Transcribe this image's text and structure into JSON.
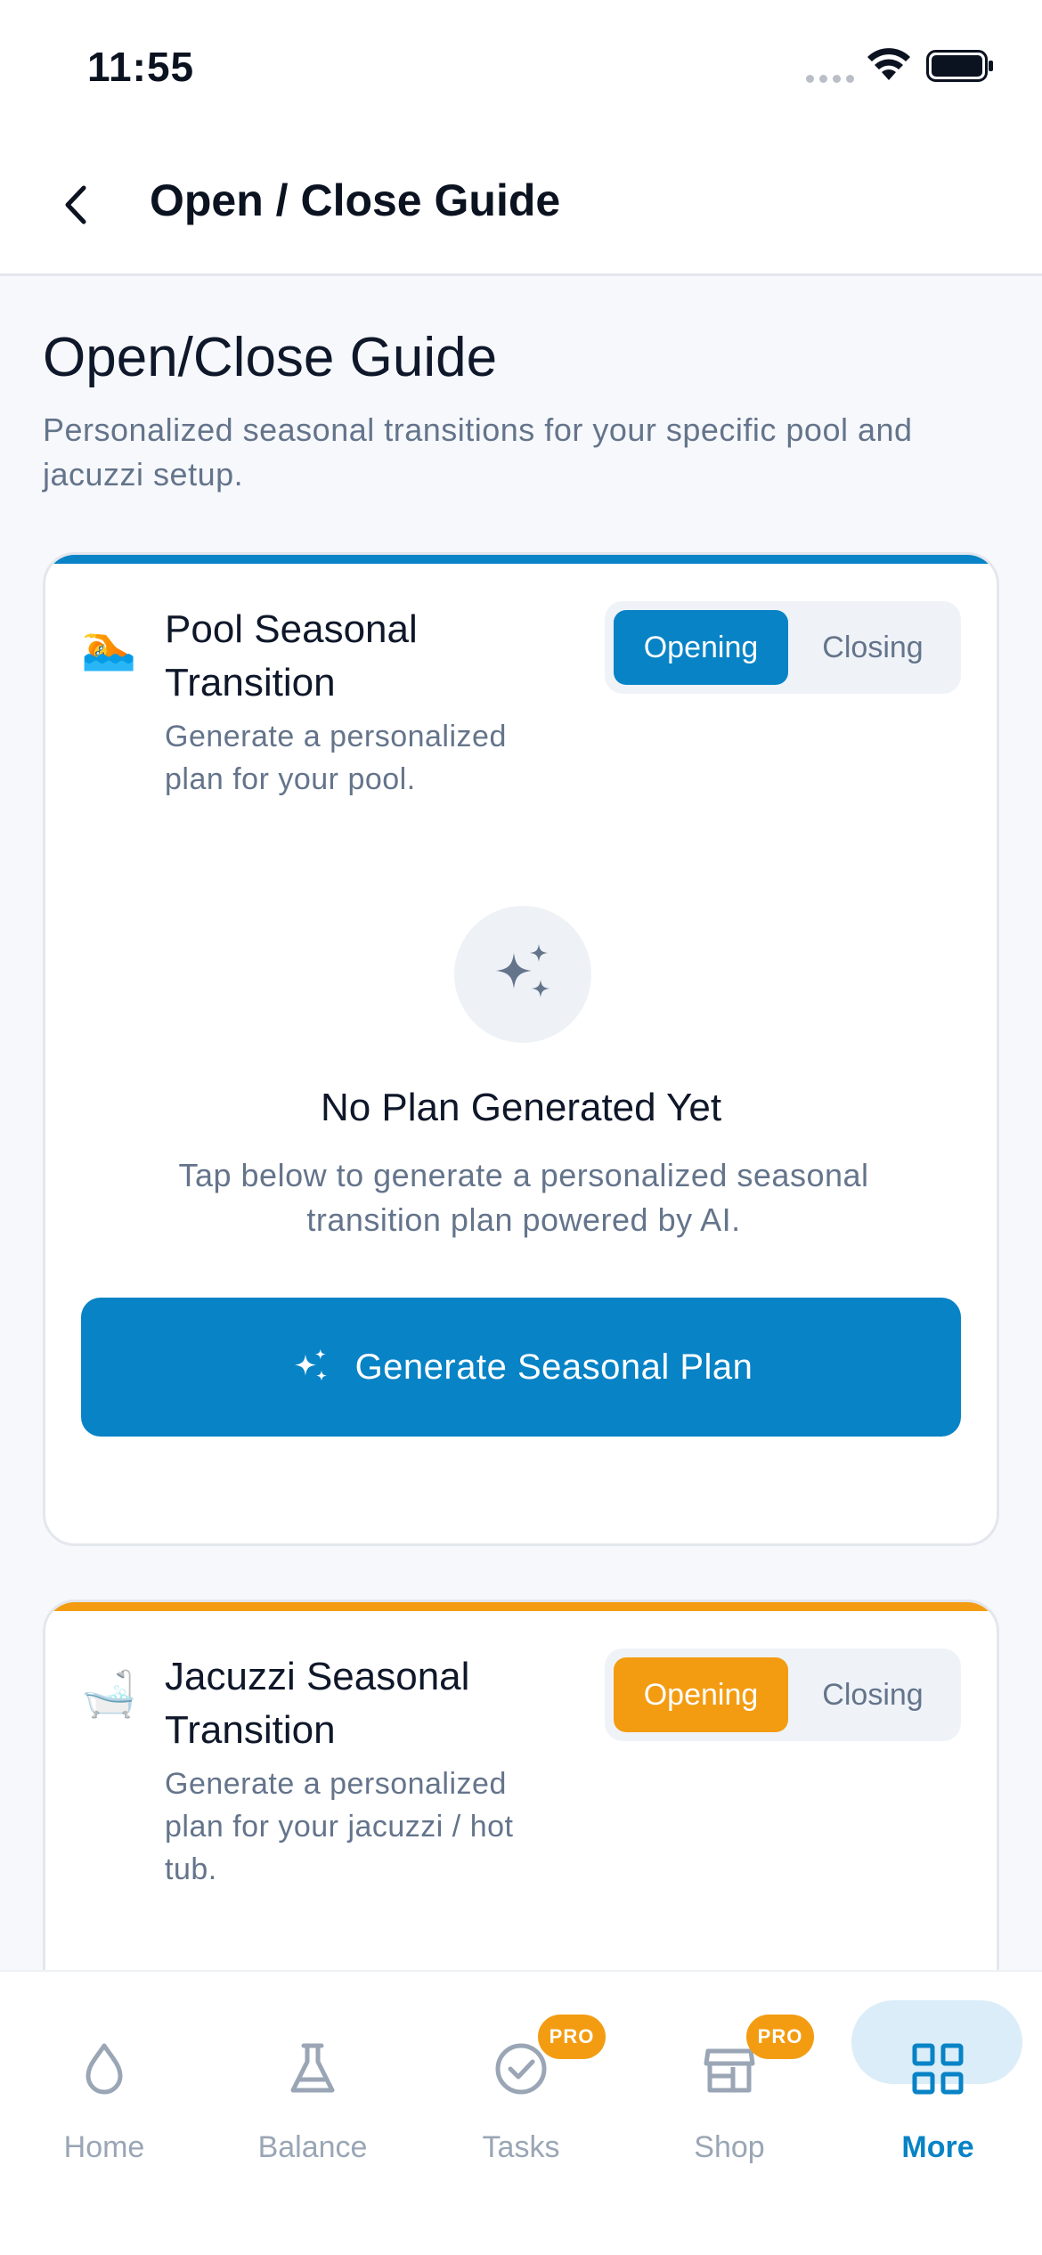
{
  "status_bar": {
    "time": "11:55"
  },
  "header": {
    "title": "Open / Close Guide"
  },
  "page": {
    "title": "Open/Close Guide",
    "subtitle": "Personalized seasonal transitions for your specific pool and jacuzzi setup."
  },
  "pool_card": {
    "icon": "🏊",
    "title": "Pool Seasonal Transition",
    "description": "Generate a personalized plan for your pool.",
    "opening_label": "Opening",
    "closing_label": "Closing",
    "selected": "Opening",
    "accent_color": "#0783c6",
    "empty_title": "No Plan Generated Yet",
    "empty_description": "Tap below to generate a personalized seasonal transition plan powered by AI.",
    "generate_label": "Generate Seasonal Plan"
  },
  "jacuzzi_card": {
    "icon": "🛁",
    "title": "Jacuzzi Seasonal Transition",
    "description": "Generate a personalized plan for your jacuzzi / hot tub.",
    "opening_label": "Opening",
    "closing_label": "Closing",
    "selected": "Opening",
    "accent_color": "#f39c12"
  },
  "tab_bar": {
    "tabs": [
      {
        "label": "Home",
        "icon": "droplet-icon"
      },
      {
        "label": "Balance",
        "icon": "flask-icon"
      },
      {
        "label": "Tasks",
        "icon": "check-circle-icon",
        "badge": "PRO"
      },
      {
        "label": "Shop",
        "icon": "store-icon",
        "badge": "PRO"
      },
      {
        "label": "More",
        "icon": "grid-icon",
        "active": true
      }
    ]
  },
  "colors": {
    "primary": "#0783c6",
    "warning": "#f39c12",
    "muted_text": "#64748b"
  }
}
